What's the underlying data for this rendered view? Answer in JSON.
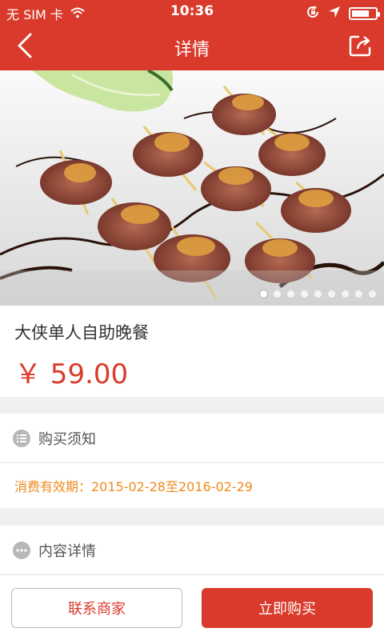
{
  "status_bar": {
    "carrier": "无 SIM 卡",
    "time": "10:36",
    "battery_level": 0.65
  },
  "nav": {
    "title": "详情",
    "back_icon": "back-chevron-icon",
    "share_icon": "share-icon"
  },
  "banner": {
    "image": "bacon-wrapped-rolls-photo",
    "dot_count": 9,
    "active_dot": 0
  },
  "product": {
    "name": "大侠单人自助晚餐",
    "price": "￥ 59.00"
  },
  "purchase_notice": {
    "title": "购买须知",
    "icon": "list-icon",
    "validity": "消费有效期：2015-02-28至2016-02-29"
  },
  "content_details": {
    "title": "内容详情",
    "icon": "more-dots-icon"
  },
  "actions": {
    "contact_label": "联系商家",
    "buy_label": "立即购买"
  },
  "colors": {
    "brand": "#d93a2b",
    "notice": "#f08a1e",
    "background": "#f0f0f0"
  }
}
